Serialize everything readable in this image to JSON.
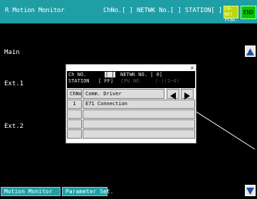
{
  "titlebar": {
    "title": "R Motion Monitor",
    "channel": "ChNo.[ ] NETWK No.[   ] STATION[   ]",
    "net_badge": "CH-NET PCNo.",
    "end_label": "END"
  },
  "side_labels": {
    "main": "Main",
    "ext1": "Ext.1",
    "ext2": "Ext.2"
  },
  "dialog": {
    "close_label": "×",
    "info": {
      "chno_label": "Ch NO.",
      "chno_value": "[ ]",
      "netwk_label": "NETWK NO. [ 0]",
      "station_label": "STATION",
      "station_value": "[ FF]",
      "cpu_label": "CPU NO.",
      "cpu_value": "(-)(1~4)"
    },
    "table": {
      "col_chno": "ChNo",
      "col_driver": "Comm. Driver",
      "rows": [
        {
          "chno": "1",
          "driver": "E71 Connection"
        },
        {
          "chno": "",
          "driver": ""
        },
        {
          "chno": "",
          "driver": ""
        },
        {
          "chno": "",
          "driver": ""
        },
        {
          "chno": "",
          "driver": ""
        }
      ]
    }
  },
  "bottom": {
    "motion_monitor": "Motion Monitor",
    "parameter_set": "Parameter Set."
  },
  "colors": {
    "accent": "#1f9ea6",
    "end_button": "#00c800",
    "net_badge": "#b9d900"
  }
}
